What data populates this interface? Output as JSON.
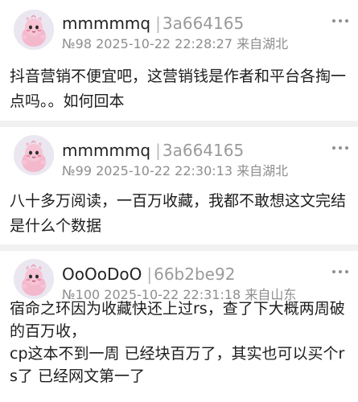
{
  "posts": [
    {
      "username": "mmmmmq",
      "user_id": "3a664165",
      "post_number": "№98",
      "timestamp": "2025-10-22 22:28:27",
      "location": "来自湖北",
      "content": "抖音营销不便宜吧，这营销钱是作者和平台各掏一点吗。。如何回本"
    },
    {
      "username": "mmmmmq",
      "user_id": "3a664165",
      "post_number": "№99",
      "timestamp": "2025-10-22 22:30:13",
      "location": "来自湖北",
      "content": "八十多万阅读，一百万收藏，我都不敢想这文完结是什么个数据"
    },
    {
      "username": "OoOoDoO",
      "user_id": "66b2be92",
      "post_number": "№100",
      "timestamp": "2025-10-22 22:31:18",
      "location": "来自山东",
      "content": "宿命之环因为收藏快还上过rs，查了下大概两周破的百万收，\ncp这本不到一周 已经块百万了，其实也可以买个rs了 已经网文第一了"
    }
  ],
  "icons": {
    "avatar": "pink-cartoon-avatar-icon",
    "more": "more-options-icon"
  },
  "colors": {
    "background": "#f1f1f1",
    "card": "#ffffff",
    "meta_text": "#8e8e8e",
    "avatar_pink": "#f3b8cc"
  }
}
